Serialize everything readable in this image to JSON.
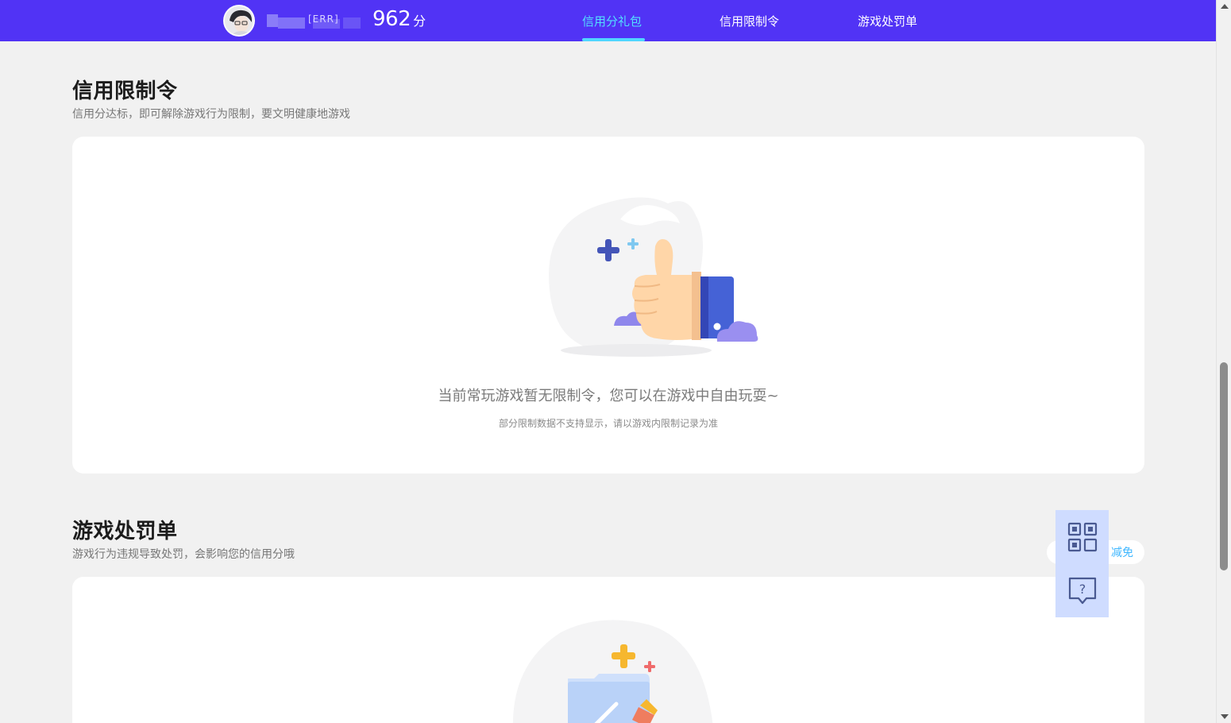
{
  "header": {
    "username_masked": "[ERR]",
    "score": "962",
    "score_unit": "分",
    "tabs": [
      {
        "label": "信用分礼包",
        "active": true
      },
      {
        "label": "信用限制令",
        "active": false
      },
      {
        "label": "游戏处罚单",
        "active": false
      }
    ],
    "accent_color": "#5133f5",
    "active_tab_color": "#53e0ff"
  },
  "restriction_section": {
    "title": "信用限制令",
    "subtitle": "信用分达标，即可解除游戏行为限制，要文明健康地游戏",
    "empty_message": "当前常玩游戏暂无限制令，您可以在游戏中自由玩耍~",
    "empty_note": "部分限制数据不支持显示，请以游戏内限制记录为准"
  },
  "penalty_section": {
    "title": "游戏处罚单",
    "subtitle": "游戏行为违规导致处罚，会影响您的信用分哦",
    "side_link": "减免"
  },
  "float_tools": {
    "items": [
      "qr-code",
      "help-feedback"
    ]
  }
}
